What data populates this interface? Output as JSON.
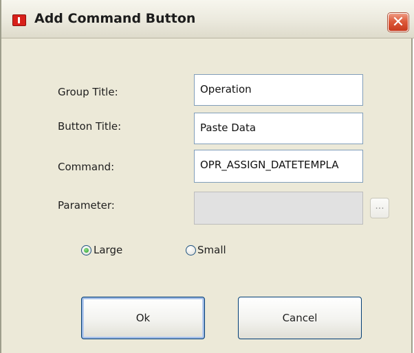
{
  "window": {
    "title": "Add Command Button",
    "close_icon": "close-icon"
  },
  "form": {
    "group_title_label": "Group Title:",
    "group_title_value": "Operation",
    "button_title_label": "Button Title:",
    "button_title_value": "Paste Data",
    "command_label": "Command:",
    "command_value": "OPR_ASSIGN_DATETEMPLA",
    "parameter_label": "Parameter:",
    "parameter_value": "",
    "browse_label": "..."
  },
  "size_options": {
    "large_label": "Large",
    "small_label": "Small",
    "selected": "Large"
  },
  "buttons": {
    "ok_label": "Ok",
    "cancel_label": "Cancel"
  },
  "colors": {
    "window_bg": "#ece9d8",
    "close_button": "#dd5a3a",
    "radio_selected": "#2a9b2a",
    "field_border": "#7f9db9"
  }
}
